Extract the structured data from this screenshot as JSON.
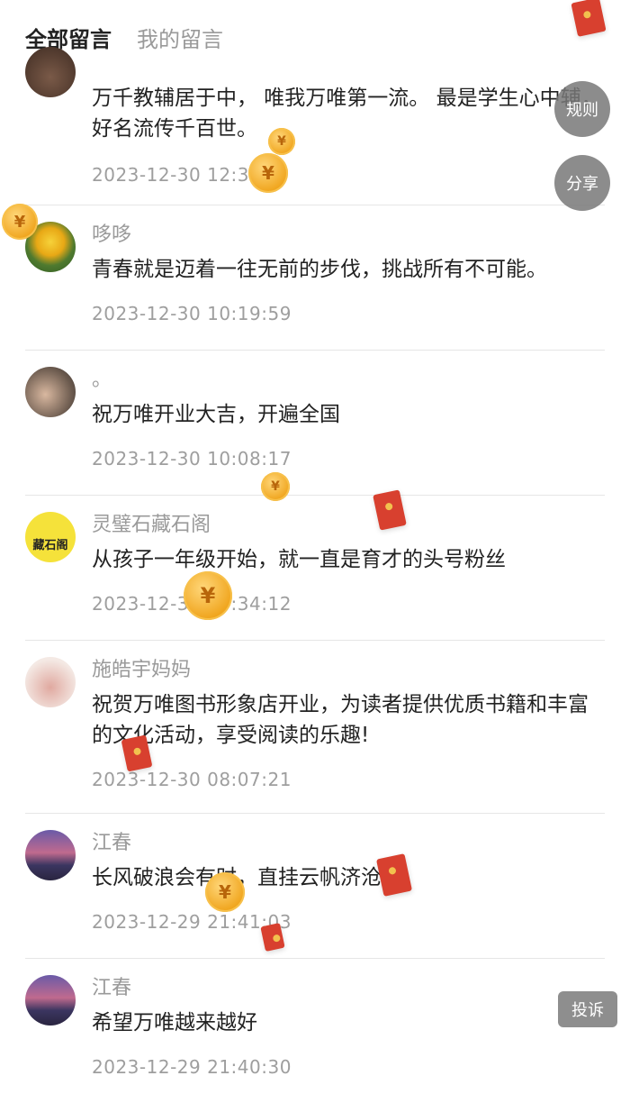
{
  "tabs": {
    "all": "全部留言",
    "mine": "我的留言"
  },
  "side_buttons": {
    "rules": "规则",
    "share": "分享",
    "complain": "投诉"
  },
  "coin_symbol": "¥",
  "comments": [
    {
      "name": "",
      "content": "万千教辅居于中， 唯我万唯第一流。 最是学生心中辅， 好名流传千百世。",
      "time": "2023-12-30 12:30"
    },
    {
      "name": "哆哆",
      "content": "青春就是迈着一往无前的步伐，挑战所有不可能。",
      "time": "2023-12-30 10:19:59"
    },
    {
      "name": "。",
      "content": "祝万唯开业大吉，开遍全国",
      "time": "2023-12-30 10:08:17"
    },
    {
      "name": "灵璧石藏石阁",
      "content": "从孩子一年级开始，就一直是育才的头号粉丝",
      "time": "2023-12-30 09:34:12",
      "avatar_text": "藏石阁"
    },
    {
      "name": "施皓宇妈妈",
      "content": "祝贺万唯图书形象店开业，为读者提供优质书籍和丰富的文化活动，享受阅读的乐趣!",
      "time": "2023-12-30 08:07:21"
    },
    {
      "name": "江春",
      "content": "长风破浪会有时，直挂云帆济沧海",
      "time": "2023-12-29 21:41:03"
    },
    {
      "name": "江春",
      "content": "希望万唯越来越好",
      "time": "2023-12-29 21:40:30"
    }
  ]
}
